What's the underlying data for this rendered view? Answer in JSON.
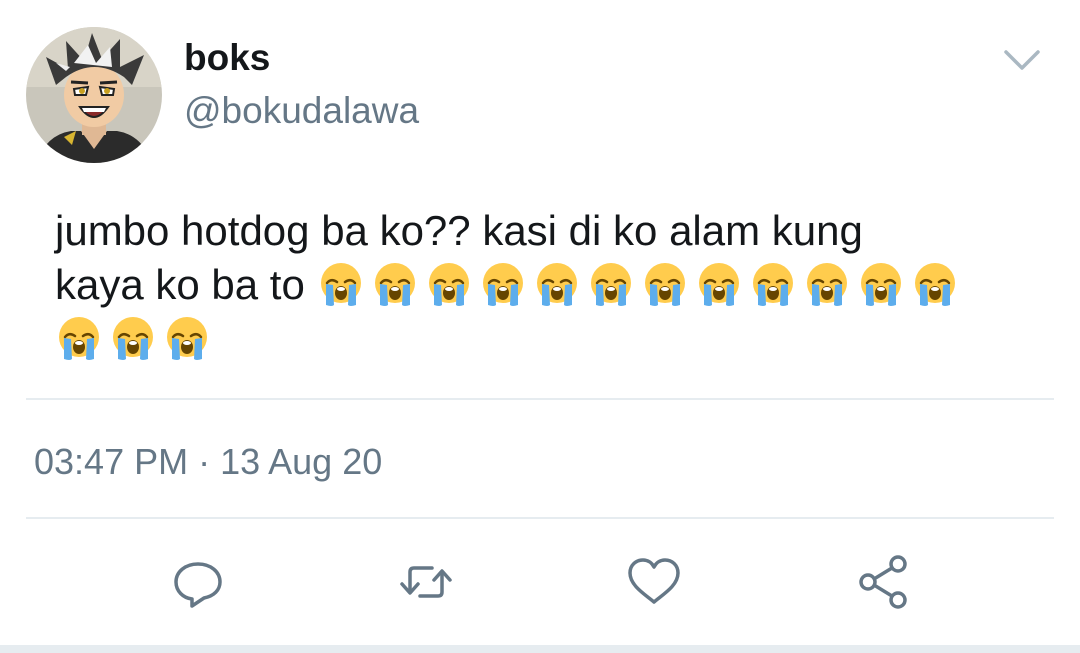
{
  "user": {
    "display_name": "boks",
    "handle": "@bokudalawa",
    "avatar_icon": "anime-character-avatar"
  },
  "tweet": {
    "text_line1": "jumbo hotdog ba ko?? kasi di ko alam kung",
    "text_line2": "kaya ko ba to",
    "emoji_name": "loudly-crying-face",
    "emoji_count": 15,
    "timestamp": "03:47 PM · 13 Aug 20"
  },
  "actions": {
    "reply_icon": "reply-icon",
    "retweet_icon": "retweet-icon",
    "like_icon": "heart-icon",
    "share_icon": "share-icon"
  },
  "colors": {
    "text_primary": "#14171a",
    "text_secondary": "#657786",
    "icon": "#657786",
    "divider": "#e6ecf0",
    "emoji_face": "#ffcc4d",
    "emoji_tears": "#5dadec"
  }
}
